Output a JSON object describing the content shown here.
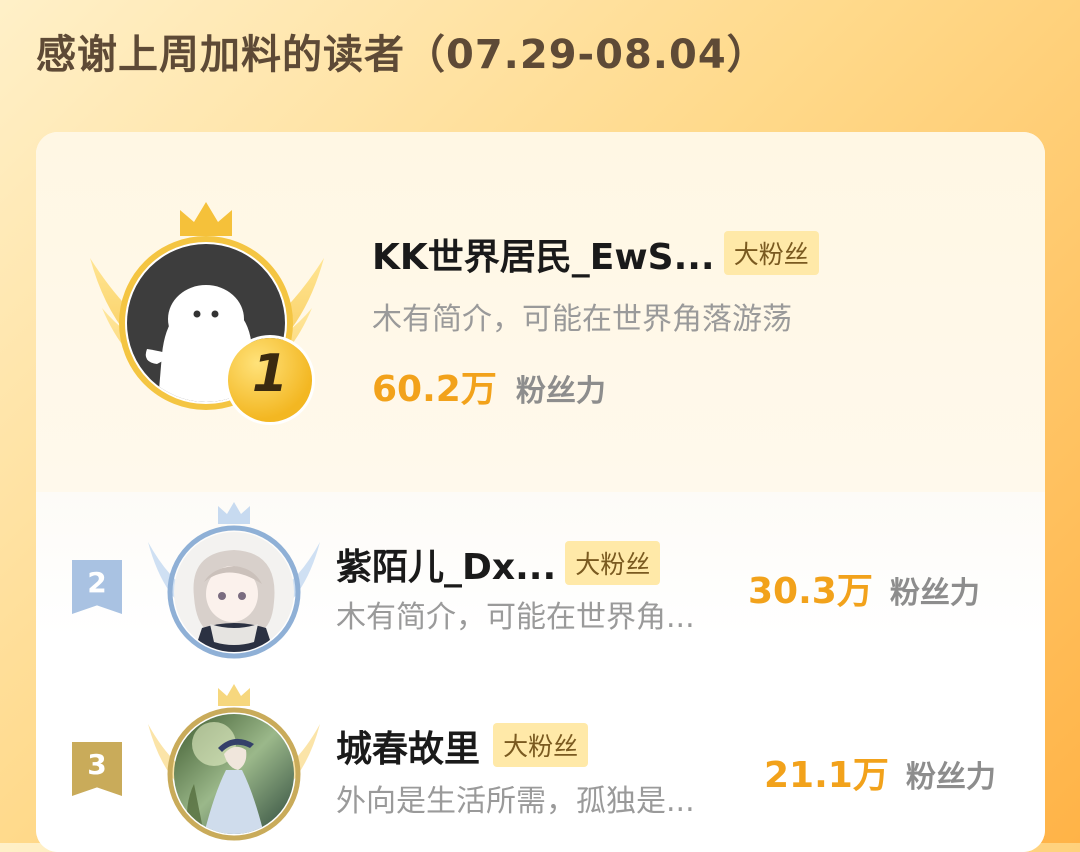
{
  "header": {
    "title": "感谢上周加料的读者（07.29-08.04）"
  },
  "readers": [
    {
      "rank": "1",
      "name": "KK世界居民_EwS...",
      "badge": "大粉丝",
      "bio": "木有简介，可能在世界角落游荡",
      "score": "60.2万",
      "score_unit": "粉丝力",
      "avatar_icon": "default-ghost-avatar"
    },
    {
      "rank": "2",
      "name": "紫陌儿_Dx...",
      "badge": "大粉丝",
      "bio": "木有简介，可能在世界角...",
      "score": "30.3万",
      "score_unit": "粉丝力",
      "avatar_icon": "anime-girl-avatar"
    },
    {
      "rank": "3",
      "name": "城春故里",
      "badge": "大粉丝",
      "bio": "外向是生活所需，孤独是...",
      "score": "21.1万",
      "score_unit": "粉丝力",
      "avatar_icon": "painting-avatar"
    }
  ],
  "colors": {
    "accent": "#f2a21b",
    "gold": "#f4c542",
    "silver_blue": "#8fb0d6",
    "bronze": "#c9ab5a",
    "badge_bg": "#ffe9a8"
  }
}
